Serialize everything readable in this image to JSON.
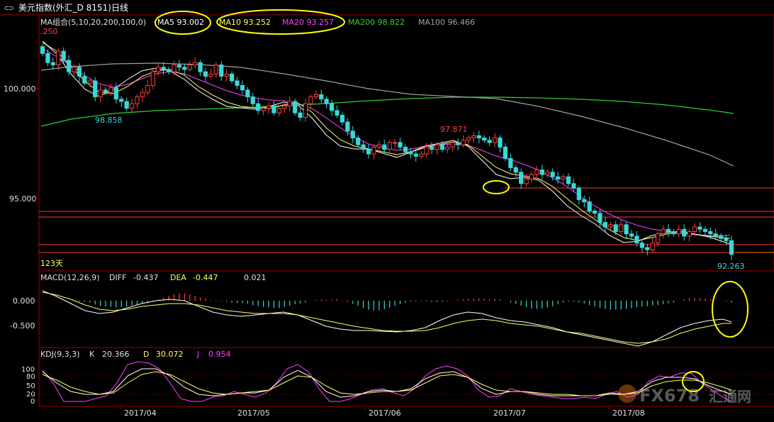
{
  "header": {
    "icon": "window-toggle-icon",
    "title": "美元指数(外汇_D 8151)日线"
  },
  "main_panel": {
    "ma_group_label": "MA组合(5,10,20,200,100,0)",
    "ma5_label": "MA5 93.002",
    "ma10_label": "MA10 93.252",
    "ma20_label": "MA20 93.257",
    "ma200_label": "MA200 98.822",
    "ma100_label": "MA100 96.466",
    "top_value_label": ".250",
    "y_ticks": [
      "100.000",
      "95.000"
    ],
    "annotations": {
      "low_label": "98.858",
      "high_label": "97.871",
      "last_low_label": "92.263",
      "days_label": "123天"
    },
    "colors": {
      "ma5": "#ffffff",
      "ma10": "#ffff60",
      "ma20": "#ff40ff",
      "ma200": "#30d030",
      "ma100": "#a0a0a0",
      "up": "#ff4040",
      "down": "#38d8d8"
    }
  },
  "macd_panel": {
    "label": "MACD(12,26,9)",
    "diff_label": "DIFF",
    "diff_value": "-0.437",
    "dea_label": "DEA",
    "dea_value": "-0.447",
    "macd_value": "0.021",
    "y_ticks": [
      "0.000",
      "-0.500"
    ]
  },
  "kdj_panel": {
    "label": "KDJ(9,3,3)",
    "k_label": "K",
    "k_value": "20.366",
    "d_label": "D",
    "d_value": "30.072",
    "j_label": "J",
    "j_value": "0.954",
    "y_ticks": [
      "100",
      "80",
      "50",
      "20",
      "0"
    ]
  },
  "x_axis": {
    "labels": [
      "2017/04",
      "2017/05",
      "2017/06",
      "2017/07",
      "2017/08"
    ]
  },
  "watermark": {
    "text": "FX678",
    "subtext": "汇通网"
  },
  "chart_data": {
    "type": "candlestick",
    "title": "美元指数(外汇_D 8151)日线",
    "x_labels": [
      "2017/04",
      "2017/05",
      "2017/06",
      "2017/07",
      "2017/08"
    ],
    "ylim": [
      92.0,
      102.5
    ],
    "y_ticks": [
      100.0,
      95.0
    ],
    "closes": [
      101.4,
      101.0,
      100.9,
      101.5,
      101.1,
      100.6,
      100.8,
      100.4,
      100.1,
      100.2,
      99.5,
      99.8,
      99.7,
      99.9,
      99.4,
      99.3,
      99.0,
      99.2,
      99.5,
      99.7,
      100.0,
      100.6,
      100.8,
      100.7,
      100.6,
      100.9,
      100.8,
      100.7,
      100.9,
      101.0,
      100.6,
      100.4,
      100.5,
      100.9,
      100.4,
      100.5,
      100.2,
      100.0,
      99.8,
      99.5,
      99.2,
      98.9,
      99.0,
      99.1,
      98.8,
      99.0,
      99.1,
      99.3,
      98.8,
      98.6,
      99.2,
      99.5,
      99.6,
      99.4,
      99.2,
      98.9,
      98.7,
      98.4,
      98.0,
      97.7,
      97.4,
      97.2,
      97.0,
      97.3,
      97.4,
      97.2,
      97.5,
      97.5,
      97.3,
      97.1,
      97.0,
      96.9,
      97.0,
      97.3,
      97.2,
      97.4,
      97.2,
      97.3,
      97.5,
      97.4,
      97.6,
      97.7,
      97.8,
      97.7,
      97.6,
      97.5,
      97.7,
      97.3,
      96.8,
      96.4,
      96.2,
      95.7,
      95.9,
      96.1,
      96.3,
      96.1,
      96.2,
      96.0,
      95.9,
      96.0,
      95.7,
      95.5,
      95.0,
      94.9,
      94.5,
      94.4,
      94.0,
      93.8,
      93.9,
      93.6,
      93.9,
      93.5,
      93.4,
      93.1,
      92.9,
      92.8,
      93.1,
      93.5,
      93.7,
      93.6,
      93.5,
      93.7,
      93.4,
      93.6,
      93.8,
      93.7,
      93.6,
      93.5,
      93.4,
      93.3,
      93.2,
      92.6
    ],
    "series": [
      {
        "name": "MA5",
        "last": 93.002
      },
      {
        "name": "MA10",
        "last": 93.252
      },
      {
        "name": "MA20",
        "last": 93.257
      },
      {
        "name": "MA200",
        "last": 98.822
      },
      {
        "name": "MA100",
        "last": 96.466
      }
    ],
    "annotations": [
      {
        "label": "98.858",
        "value": 98.858
      },
      {
        "label": "97.871",
        "value": 97.871
      },
      {
        "label": "92.263",
        "value": 92.263
      }
    ],
    "macd": {
      "diff": -0.437,
      "dea": -0.447,
      "macd": 0.021,
      "ylim": [
        -0.85,
        0.3
      ]
    },
    "kdj": {
      "k": 20.366,
      "d": 30.072,
      "j": 0.954,
      "ylim": [
        -5,
        110
      ]
    }
  }
}
